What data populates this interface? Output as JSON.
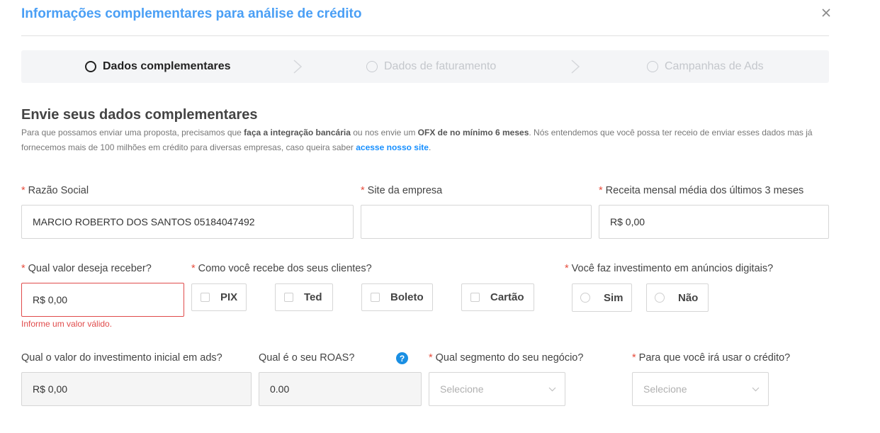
{
  "modal": {
    "title": "Informações complementares para análise de crédito"
  },
  "steps": [
    {
      "label": "Dados complementares"
    },
    {
      "label": "Dados de faturamento"
    },
    {
      "label": "Campanhas de Ads"
    }
  ],
  "section": {
    "title": "Envie seus dados complementares",
    "desc_1": "Para que possamos enviar uma proposta, precisamos que ",
    "desc_bold_1": "faça a integração bancária",
    "desc_2": " ou nos envie um ",
    "desc_bold_2": "OFX de no mínimo 6 meses",
    "desc_3": ". Nós entendemos que você possa ter receio de enviar esses dados mas já fornecemos mais de 100 milhões em crédito para diversas empresas, caso queira saber ",
    "desc_link": "acesse nosso site",
    "desc_4": "."
  },
  "form": {
    "required_mark": "*",
    "razao_social": {
      "label": "Razão Social",
      "value": "MARCIO ROBERTO DOS SANTOS 05184047492"
    },
    "site": {
      "label": "Site da empresa",
      "value": ""
    },
    "receita": {
      "label": "Receita mensal média dos últimos 3 meses",
      "value": "R$ 0,00"
    },
    "valor": {
      "label": "Qual valor deseja receber?",
      "value": "R$ 0,00",
      "error": "Informe um valor válido."
    },
    "recebe": {
      "label": "Como você recebe dos seus clientes?",
      "options": [
        "PIX",
        "Ted",
        "Boleto",
        "Cartão"
      ]
    },
    "investimento_anuncios": {
      "label": "Você faz investimento em anúncios digitais?",
      "options": [
        "Sim",
        "Não"
      ]
    },
    "investimento_inicial": {
      "label": "Qual o valor do investimento inicial em ads?",
      "value": "R$ 0,00"
    },
    "roas": {
      "label": "Qual é o seu ROAS?",
      "value": "0.00",
      "help": "?"
    },
    "segmento": {
      "label": "Qual segmento do seu negócio?",
      "placeholder": "Selecione"
    },
    "uso_credito": {
      "label": "Para que você irá usar o crédito?",
      "placeholder": "Selecione"
    }
  },
  "colors": {
    "accent": "#4a9ff5",
    "error": "#e04b4b",
    "link": "#1890ff"
  }
}
